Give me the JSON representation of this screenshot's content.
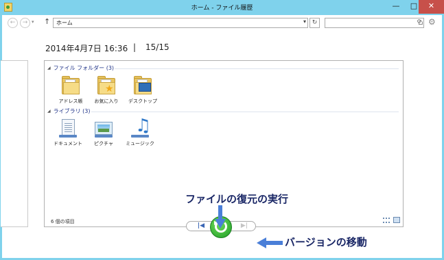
{
  "window": {
    "title": "ホーム - ファイル履歴",
    "minimize_glyph": "—",
    "maximize_glyph": "□",
    "close_glyph": "✕"
  },
  "address_bar": {
    "back_glyph": "←",
    "forward_glyph": "→",
    "dropdown_glyph": "▾",
    "up_glyph": "↑",
    "path": "ホーム",
    "path_dropdown_glyph": "▾",
    "refresh_glyph": "↻",
    "search_placeholder": "",
    "icons": [
      "back-icon",
      "forward-icon",
      "up-icon",
      "refresh-icon",
      "search-icon",
      "home-icon",
      "gear-icon"
    ]
  },
  "header": {
    "backup_date": "2014年4月7日 16:36",
    "separator": "|",
    "version_count": "15/15"
  },
  "panel": {
    "groups": [
      {
        "title": "ファイル フォルダー (3)",
        "items": [
          {
            "label": "アドレス帳",
            "icon": "folder-icon"
          },
          {
            "label": "お気に入り",
            "icon": "favorites-folder-icon"
          },
          {
            "label": "デスクトップ",
            "icon": "desktop-folder-icon"
          }
        ]
      },
      {
        "title": "ライブラリ (3)",
        "items": [
          {
            "label": "ドキュメント",
            "icon": "documents-library-icon"
          },
          {
            "label": "ピクチャ",
            "icon": "pictures-library-icon"
          },
          {
            "label": "ミュージック",
            "icon": "music-library-icon"
          }
        ]
      }
    ],
    "status_text": "6 個の項目"
  },
  "version_nav": {
    "prev_glyph": "|◀",
    "next_glyph": "▶|"
  },
  "annotations": {
    "restore": "ファイルの復元の実行",
    "move_version": "バージョンの移動",
    "color": "#1a2766",
    "arrow_color": "#4a7fd8"
  },
  "colors": {
    "frame": "#7fd2ec",
    "close_button": "#c7504a",
    "group_header": "#1e3287",
    "restore_button": "#1f9d26"
  }
}
